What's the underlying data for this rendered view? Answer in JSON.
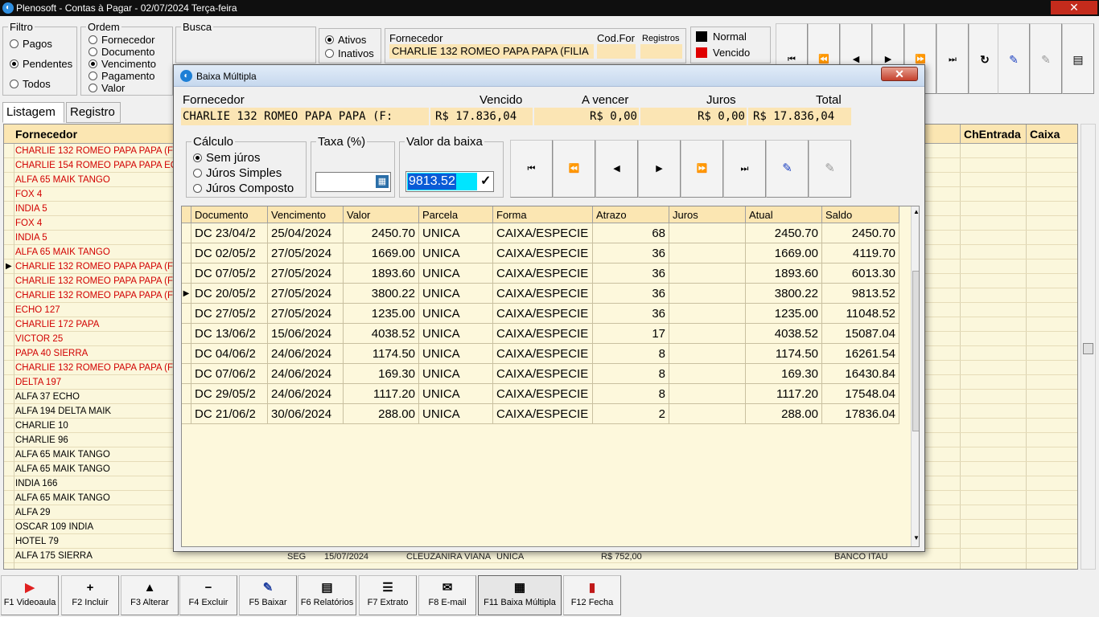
{
  "window": {
    "title": "Plenosoft - Contas à Pagar - 02/07/2024 Terça-feira",
    "close": "✕"
  },
  "filtro": {
    "title": "Filtro",
    "options": [
      "Pagos",
      "Pendentes",
      "Todos"
    ],
    "selected": 1
  },
  "ordem": {
    "title": "Ordem",
    "options": [
      "Fornecedor",
      "Documento",
      "Vencimento",
      "Pagamento",
      "Valor"
    ],
    "selected": 2
  },
  "busca": {
    "title": "Busca"
  },
  "status": {
    "options": [
      "Ativos",
      "Inativos"
    ],
    "selected": 0
  },
  "fornecedor_top": {
    "label": "Fornecedor",
    "value": "CHARLIE 132 ROMEO PAPA PAPA (FILIA",
    "codfor_label": "Cod.For",
    "registros_label": "Registros"
  },
  "legend": {
    "normal": "Normal",
    "vencido": "Vencido",
    "colors": {
      "normal": "#000000",
      "vencido": "#e00000"
    }
  },
  "tabs": [
    "Listagem",
    "Registro"
  ],
  "bglist": {
    "headers": {
      "fornecedor": "Fornecedor",
      "chentrada": "ChEntrada",
      "caixa": "Caixa"
    },
    "rows": [
      {
        "name": "CHARLIE 132 ROMEO PAPA PAPA (FILI",
        "red": true
      },
      {
        "name": "CHARLIE 154 ROMEO PAPA PAPA ECH",
        "red": true
      },
      {
        "name": "ALFA 65 MAIK TANGO",
        "red": true
      },
      {
        "name": "FOX 4",
        "red": true
      },
      {
        "name": "INDIA 5",
        "red": true
      },
      {
        "name": "FOX 4",
        "red": true
      },
      {
        "name": "INDIA 5",
        "red": true
      },
      {
        "name": "ALFA 65 MAIK TANGO",
        "red": true
      },
      {
        "name": "CHARLIE 132 ROMEO PAPA PAPA (FILI",
        "red": true
      },
      {
        "name": "CHARLIE 132 ROMEO PAPA PAPA (FILI",
        "red": true
      },
      {
        "name": "CHARLIE 132 ROMEO PAPA PAPA (FILI",
        "red": true
      },
      {
        "name": "ECHO 127",
        "red": true
      },
      {
        "name": "CHARLIE 172 PAPA",
        "red": true
      },
      {
        "name": "VICTOR 25",
        "red": true
      },
      {
        "name": "PAPA 40 SIERRA",
        "red": true
      },
      {
        "name": "CHARLIE 132 ROMEO PAPA PAPA (FILI",
        "red": true
      },
      {
        "name": "DELTA 197",
        "red": true
      },
      {
        "name": "ALFA 37 ECHO",
        "red": false
      },
      {
        "name": "ALFA 194 DELTA MAIK",
        "red": false
      },
      {
        "name": "CHARLIE 10",
        "red": false
      },
      {
        "name": "CHARLIE 96",
        "red": false
      },
      {
        "name": "ALFA 65 MAIK TANGO",
        "red": false
      },
      {
        "name": "ALFA 65 MAIK TANGO",
        "red": false
      },
      {
        "name": "INDIA 166",
        "red": false
      },
      {
        "name": "ALFA 65 MAIK TANGO",
        "red": false
      },
      {
        "name": "ALFA 29",
        "red": false
      },
      {
        "name": "OSCAR 109 INDIA",
        "red": false
      },
      {
        "name": "HOTEL 79",
        "red": false
      },
      {
        "name": "ALFA 175 SIERRA",
        "red": false
      }
    ],
    "current_row": 8,
    "last_row_extra": {
      "dia": "SEG",
      "venc": "15/07/2024",
      "resp": "CLEUZANIRA VIANA",
      "parcela": "UNICA",
      "valor": "R$ 752,00",
      "banco": "BANCO ITAU"
    }
  },
  "footer": [
    {
      "key": "f1",
      "label": "F1 Videoaula",
      "icon": "▶"
    },
    {
      "key": "f2",
      "label": "F2 Incluir",
      "icon": "+"
    },
    {
      "key": "f3",
      "label": "F3 Alterar",
      "icon": "▲"
    },
    {
      "key": "f4",
      "label": "F4 Excluir",
      "icon": "−"
    },
    {
      "key": "f5",
      "label": "F5 Baixar",
      "icon": "✎"
    },
    {
      "key": "f6",
      "label": "F6 Relatórios",
      "icon": "▤"
    },
    {
      "key": "f7",
      "label": "F7 Extrato",
      "icon": "☰"
    },
    {
      "key": "f8",
      "label": "F8 E-mail",
      "icon": "✉"
    },
    {
      "key": "f11",
      "label": "F11 Baixa Múltipla",
      "icon": "▦"
    },
    {
      "key": "f12",
      "label": "F12 Fecha",
      "icon": "▮"
    }
  ],
  "dialog": {
    "title": "Baixa Múltipla",
    "close": "✕",
    "summary": {
      "fornecedor_label": "Fornecedor",
      "fornecedor": "CHARLIE 132 ROMEO PAPA PAPA (F:",
      "vencido_label": "Vencido",
      "vencido": "R$ 17.836,04",
      "avencer_label": "A vencer",
      "avencer": "R$ 0,00",
      "juros_label": "Juros",
      "juros": "R$ 0,00",
      "total_label": "Total",
      "total": "R$ 17.836,04"
    },
    "calculo": {
      "title": "Cálculo",
      "options": [
        "Sem júros",
        "Júros Simples",
        "Júros Composto"
      ],
      "selected": 0
    },
    "taxa": {
      "label": "Taxa (%)",
      "value": ""
    },
    "valor_baixa": {
      "label": "Valor da baixa",
      "value": "9813.52",
      "confirm": "✓"
    },
    "grid": {
      "headers": [
        "Documento",
        "Vencimento",
        "Valor",
        "Parcela",
        "Forma",
        "Atrazo",
        "Juros",
        "Atual",
        "Saldo"
      ],
      "rows": [
        [
          "DC 23/04/2",
          "25/04/2024",
          "2450.70",
          "UNICA",
          "CAIXA/ESPECIE",
          "68",
          "",
          "2450.70",
          "2450.70"
        ],
        [
          "DC 02/05/2",
          "27/05/2024",
          "1669.00",
          "UNICA",
          "CAIXA/ESPECIE",
          "36",
          "",
          "1669.00",
          "4119.70"
        ],
        [
          "DC 07/05/2",
          "27/05/2024",
          "1893.60",
          "UNICA",
          "CAIXA/ESPECIE",
          "36",
          "",
          "1893.60",
          "6013.30"
        ],
        [
          "DC 20/05/2",
          "27/05/2024",
          "3800.22",
          "UNICA",
          "CAIXA/ESPECIE",
          "36",
          "",
          "3800.22",
          "9813.52"
        ],
        [
          "DC 27/05/2",
          "27/05/2024",
          "1235.00",
          "UNICA",
          "CAIXA/ESPECIE",
          "36",
          "",
          "1235.00",
          "11048.52"
        ],
        [
          "DC 13/06/2",
          "15/06/2024",
          "4038.52",
          "UNICA",
          "CAIXA/ESPECIE",
          "17",
          "",
          "4038.52",
          "15087.04"
        ],
        [
          "DC 04/06/2",
          "24/06/2024",
          "1174.50",
          "UNICA",
          "CAIXA/ESPECIE",
          "8",
          "",
          "1174.50",
          "16261.54"
        ],
        [
          "DC 07/06/2",
          "24/06/2024",
          "169.30",
          "UNICA",
          "CAIXA/ESPECIE",
          "8",
          "",
          "169.30",
          "16430.84"
        ],
        [
          "DC 29/05/2",
          "24/06/2024",
          "1117.20",
          "UNICA",
          "CAIXA/ESPECIE",
          "8",
          "",
          "1117.20",
          "17548.04"
        ],
        [
          "DC 21/06/2",
          "30/06/2024",
          "288.00",
          "UNICA",
          "CAIXA/ESPECIE",
          "2",
          "",
          "288.00",
          "17836.04"
        ]
      ],
      "current_row": 3
    }
  }
}
